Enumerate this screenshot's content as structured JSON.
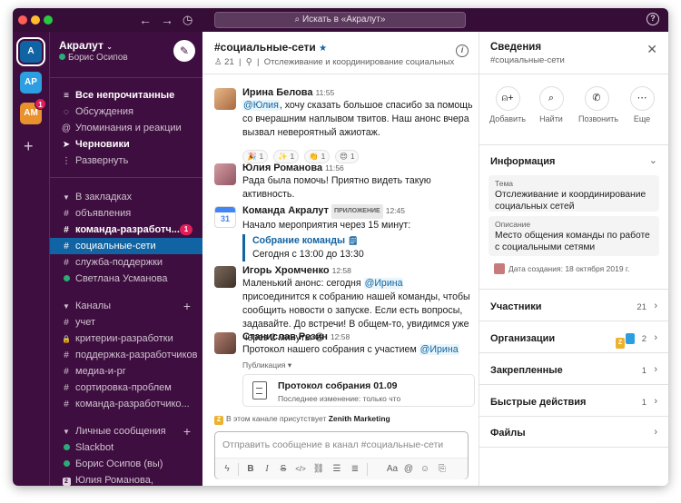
{
  "titlebar": {
    "search_placeholder": "Искать в «Акралут»",
    "help_icon": "?"
  },
  "rail": {
    "workspaces": [
      {
        "initials": "А",
        "active": true
      },
      {
        "initials": "АР"
      },
      {
        "initials": "АМ",
        "badge": "1"
      }
    ]
  },
  "sidebar": {
    "workspace_name": "Акралут",
    "user_name": "Борис Осипов",
    "nav": [
      {
        "label": "Все непрочитанные",
        "icon": "≡"
      },
      {
        "label": "Обсуждения",
        "icon": "◌"
      },
      {
        "label": "Упоминания и реакции",
        "icon": "@"
      },
      {
        "label": "Черновики",
        "icon": "➤"
      },
      {
        "label": "Развернуть",
        "icon": "⋮"
      }
    ],
    "bookmarks_header": "В закладках",
    "bookmarks": [
      {
        "label": "объявления",
        "icon": "#"
      },
      {
        "label": "команда-разработч...",
        "icon": "#",
        "badge": "1"
      },
      {
        "label": "социальные-сети",
        "icon": "#",
        "selected": true
      },
      {
        "label": "служба-поддержки",
        "icon": "#"
      },
      {
        "label": "Светлана Усманова",
        "icon": "●"
      }
    ],
    "channels_header": "Каналы",
    "channels": [
      {
        "label": "учет",
        "icon": "#"
      },
      {
        "label": "критерии-разработки",
        "icon": "🔒"
      },
      {
        "label": "поддержка-разработчиков",
        "icon": "#"
      },
      {
        "label": "медиа-и-pr",
        "icon": "#"
      },
      {
        "label": "сортировка-проблем",
        "icon": "#"
      },
      {
        "label": "команда-разработчико...",
        "icon": "#"
      }
    ],
    "dms_header": "Личные сообщения",
    "dms": [
      {
        "label": "Slackbot"
      },
      {
        "label": "Борис Осипов (вы)"
      },
      {
        "label": "Юлия Романова,"
      }
    ]
  },
  "channel": {
    "name": "#социальные-сети",
    "members": "21",
    "separator": "|",
    "topic": "Отслеживание и координирование социальных...",
    "messages": [
      {
        "author": "Ирина Белова",
        "time": "11:55",
        "mention": "@Юлия",
        "text": ", хочу сказать большое спасибо за помощь со вчерашним наплывом твитов. Наш анонс вчера вызвал невероятный ажиотаж.",
        "reactions": [
          {
            "emoji": "🎉",
            "count": "1"
          },
          {
            "emoji": "✨",
            "count": "1"
          },
          {
            "emoji": "👏",
            "count": "1"
          },
          {
            "emoji": "😍",
            "count": "1"
          }
        ]
      },
      {
        "author": "Юлия Романова",
        "time": "11:56",
        "text": "Рада была помочь! Приятно видеть такую активность."
      },
      {
        "author": "Команда Акралут",
        "tag": "ПРИЛОЖЕНИЕ",
        "time": "12:45",
        "text": "Начало мероприятия через 15 минут:",
        "event_title": "Собрание команды",
        "event_emoji": "🗒",
        "event_time": "Сегодня с 13:00 до 13:30",
        "calendar_day": "31"
      },
      {
        "author": "Игорь Хромченко",
        "time": "12:58",
        "text_before": "Маленький анонс: сегодня ",
        "mention": "@Ирина",
        "text_after": " присоединится к собранию нашей команды, чтобы сообщить новости о запуске. Если есть вопросы, задавайте. До встречи! В общем-то, увидимся уже через 2 минуты 😄"
      },
      {
        "author": "Станислав Резин",
        "time": "12:58",
        "text": "Протокол нашего собрания с участием ",
        "mention": "@Ирина",
        "share_label": "Публикация ▾",
        "file_title": "Протокол собрания 01.09",
        "file_sub": "Последнее изменение: только что"
      }
    ],
    "presence_prefix": "В этом канале присутствует ",
    "presence_org": "Zenith Marketing",
    "presence_badge": "Z",
    "composer_placeholder": "Отправить сообщение в канал #социальные-сети"
  },
  "details": {
    "title": "Сведения",
    "subtitle": "#социальные-сети",
    "actions": [
      {
        "label": "Добавить",
        "icon": "person-add-icon"
      },
      {
        "label": "Найти",
        "icon": "search-list-icon"
      },
      {
        "label": "Позвонить",
        "icon": "phone-icon"
      },
      {
        "label": "Еще",
        "icon": "more-icon"
      }
    ],
    "info_title": "Информация",
    "topic_label": "Тема",
    "topic_value": "Отслеживание и координирование социальных сетей",
    "desc_label": "Описание",
    "desc_value": "Место общения команды по работе с социальными сетями",
    "created": "Дата создания: 18 октября 2019 г.",
    "members_title": "Участники",
    "members_count": "21",
    "orgs_title": "Организации",
    "orgs_count": "2",
    "orgs_badge": "Z",
    "pinned_title": "Закрепленные",
    "pinned_count": "1",
    "shortcuts_title": "Быстрые действия",
    "shortcuts_count": "1",
    "files_title": "Файлы"
  }
}
